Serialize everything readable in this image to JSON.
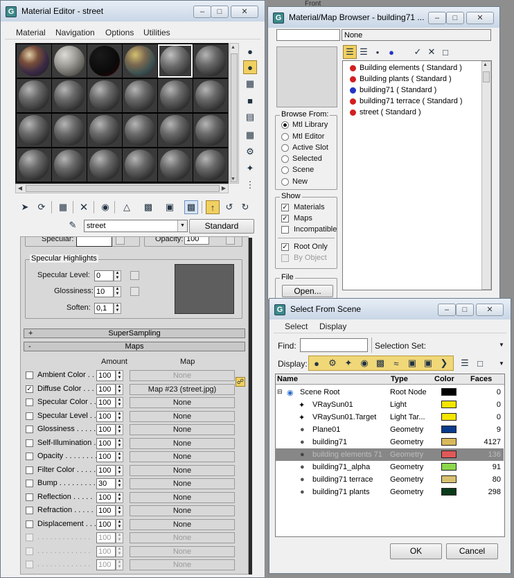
{
  "viewport_label": "Front",
  "material_editor": {
    "title": "Material Editor - street",
    "menu": [
      "Material",
      "Navigation",
      "Options",
      "Utilities"
    ],
    "material_name": "street",
    "material_type": "Standard",
    "cropped_row": {
      "specular": "Specular:",
      "opacity": "Opacity:",
      "opacity_value": "100"
    },
    "specular_highlights": {
      "title": "Specular Highlights",
      "specular_level_label": "Specular Level:",
      "specular_level": "0",
      "glossiness_label": "Glossiness:",
      "glossiness": "10",
      "soften_label": "Soften:",
      "soften": "0,1"
    },
    "rollouts": {
      "supersampling": "SuperSampling",
      "maps": "Maps"
    },
    "plus": "+",
    "minus": "-",
    "maps_headers": {
      "amount": "Amount",
      "map": "Map"
    },
    "maps": [
      {
        "label": "Ambient Color . . .",
        "checked": false,
        "amount": "100",
        "map": "None",
        "disabled": true
      },
      {
        "label": "Diffuse Color . . . .",
        "checked": true,
        "amount": "100",
        "map": "Map #23 (street.jpg)",
        "disabled": false
      },
      {
        "label": "Specular Color . .",
        "checked": false,
        "amount": "100",
        "map": "None",
        "disabled": false
      },
      {
        "label": "Specular Level . .",
        "checked": false,
        "amount": "100",
        "map": "None",
        "disabled": false
      },
      {
        "label": "Glossiness . . . . .",
        "checked": false,
        "amount": "100",
        "map": "None",
        "disabled": false
      },
      {
        "label": "Self-Illumination .",
        "checked": false,
        "amount": "100",
        "map": "None",
        "disabled": false
      },
      {
        "label": "Opacity . . . . . . . .",
        "checked": false,
        "amount": "100",
        "map": "None",
        "disabled": false
      },
      {
        "label": "Filter Color . . . . .",
        "checked": false,
        "amount": "100",
        "map": "None",
        "disabled": false
      },
      {
        "label": "Bump . . . . . . . . .",
        "checked": false,
        "amount": "30",
        "map": "None",
        "disabled": false
      },
      {
        "label": "Reflection . . . . .",
        "checked": false,
        "amount": "100",
        "map": "None",
        "disabled": false
      },
      {
        "label": "Refraction . . . . .",
        "checked": false,
        "amount": "100",
        "map": "None",
        "disabled": false
      },
      {
        "label": "Displacement . . .",
        "checked": false,
        "amount": "100",
        "map": "None",
        "disabled": false
      },
      {
        "label": ". . . . . . . . . . . . .",
        "checked": false,
        "amount": "100",
        "map": "None",
        "disabled": true
      },
      {
        "label": ". . . . . . . . . . . . .",
        "checked": false,
        "amount": "100",
        "map": "None",
        "disabled": true
      },
      {
        "label": ". . . . . . . . . . . . .",
        "checked": false,
        "amount": "100",
        "map": "None",
        "disabled": true
      }
    ]
  },
  "browser": {
    "title": "Material/Map Browser - building71 ...",
    "current": "None",
    "items": [
      {
        "label": "Building elements  ( Standard )",
        "color": "#d21f1f"
      },
      {
        "label": "Building plants  ( Standard )",
        "color": "#d21f1f"
      },
      {
        "label": "building71  ( Standard )",
        "color": "#2436c4"
      },
      {
        "label": "building71 terrace  ( Standard )",
        "color": "#d21f1f"
      },
      {
        "label": "street  ( Standard )",
        "color": "#d21f1f"
      }
    ],
    "browse_from": {
      "title": "Browse From:",
      "options": [
        "Mtl Library",
        "Mtl Editor",
        "Active Slot",
        "Selected",
        "Scene",
        "New"
      ],
      "selected": 0
    },
    "show": {
      "title": "Show",
      "options": [
        {
          "label": "Materials",
          "checked": true
        },
        {
          "label": "Maps",
          "checked": true
        },
        {
          "label": "Incompatible",
          "checked": false
        }
      ]
    },
    "root_only": {
      "label": "Root Only",
      "checked": true
    },
    "by_object": {
      "label": "By Object",
      "checked": false
    },
    "file": {
      "title": "File",
      "open": "Open..."
    }
  },
  "select_scene": {
    "title": "Select From Scene",
    "menu": [
      "Select",
      "Display"
    ],
    "find_label": "Find:",
    "selection_set_label": "Selection Set:",
    "display_label": "Display:",
    "columns": [
      "Name",
      "Type",
      "Color",
      "Faces"
    ],
    "rows": [
      {
        "name": "Scene Root",
        "type": "Root Node",
        "color": "#000000",
        "faces": "0",
        "selected": false
      },
      {
        "name": "VRaySun01",
        "type": "Light",
        "color": "#f4e600",
        "faces": "0",
        "selected": false
      },
      {
        "name": "VRaySun01.Target",
        "type": "Light Tar...",
        "color": "#f4e600",
        "faces": "0",
        "selected": false
      },
      {
        "name": "Plane01",
        "type": "Geometry",
        "color": "#0a3a8a",
        "faces": "9",
        "selected": false
      },
      {
        "name": "building71",
        "type": "Geometry",
        "color": "#d8b85a",
        "faces": "4127",
        "selected": false
      },
      {
        "name": "building elements 71",
        "type": "Geometry",
        "color": "#e05858",
        "faces": "136",
        "selected": true
      },
      {
        "name": "building71_alpha",
        "type": "Geometry",
        "color": "#8cd84c",
        "faces": "91",
        "selected": false
      },
      {
        "name": "building71 terrace",
        "type": "Geometry",
        "color": "#d8c070",
        "faces": "80",
        "selected": false
      },
      {
        "name": "building71 plants",
        "type": "Geometry",
        "color": "#0a3a1a",
        "faces": "298",
        "selected": false
      }
    ],
    "ok": "OK",
    "cancel": "Cancel"
  }
}
